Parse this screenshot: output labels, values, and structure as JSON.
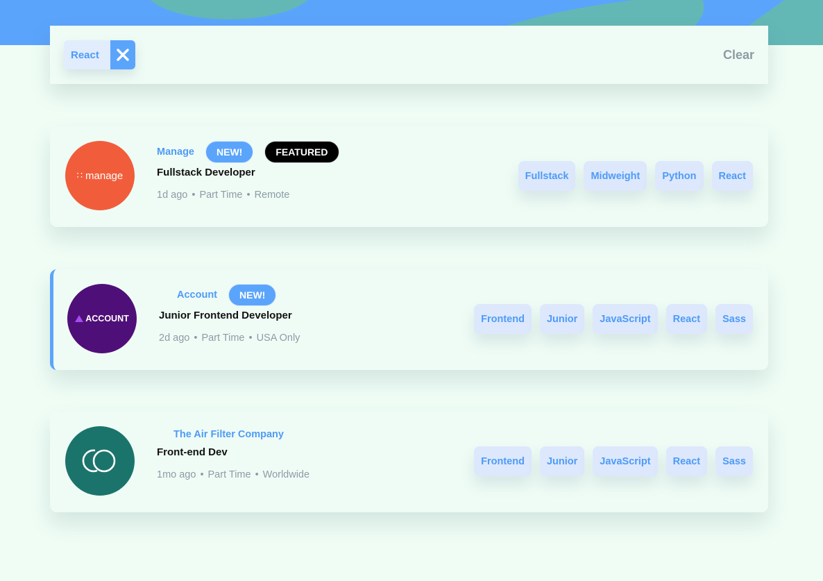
{
  "filter": {
    "active_tags": [
      "React"
    ],
    "clear_label": "Clear"
  },
  "jobs": [
    {
      "company": "Manage",
      "logo_text": "manage",
      "logo_color": "#f15d3b",
      "new_label": "NEW!",
      "featured_label": "FEATURED",
      "position": "Fullstack Developer",
      "posted": "1d ago",
      "contract": "Part Time",
      "location": "Remote",
      "tags": [
        "Fullstack",
        "Midweight",
        "Python",
        "React"
      ]
    },
    {
      "company": "Account",
      "logo_text": "ACCOUNT",
      "logo_color": "#4f0f78",
      "new_label": "NEW!",
      "position": "Junior Frontend Developer",
      "posted": "2d ago",
      "contract": "Part Time",
      "location": "USA Only",
      "tags": [
        "Frontend",
        "Junior",
        "JavaScript",
        "React",
        "Sass"
      ]
    },
    {
      "company": "The Air Filter Company",
      "logo_color": "#1b746b",
      "position": "Front-end Dev",
      "posted": "1mo ago",
      "contract": "Part Time",
      "location": "Worldwide",
      "tags": [
        "Frontend",
        "Junior",
        "JavaScript",
        "React",
        "Sass"
      ]
    }
  ],
  "colors": {
    "primary": "#5ba4fc",
    "background": "#effdf5",
    "tag_bg": "#dde8fc",
    "muted_text": "#8d9ba6",
    "banner_accent": "#63b8b6"
  }
}
